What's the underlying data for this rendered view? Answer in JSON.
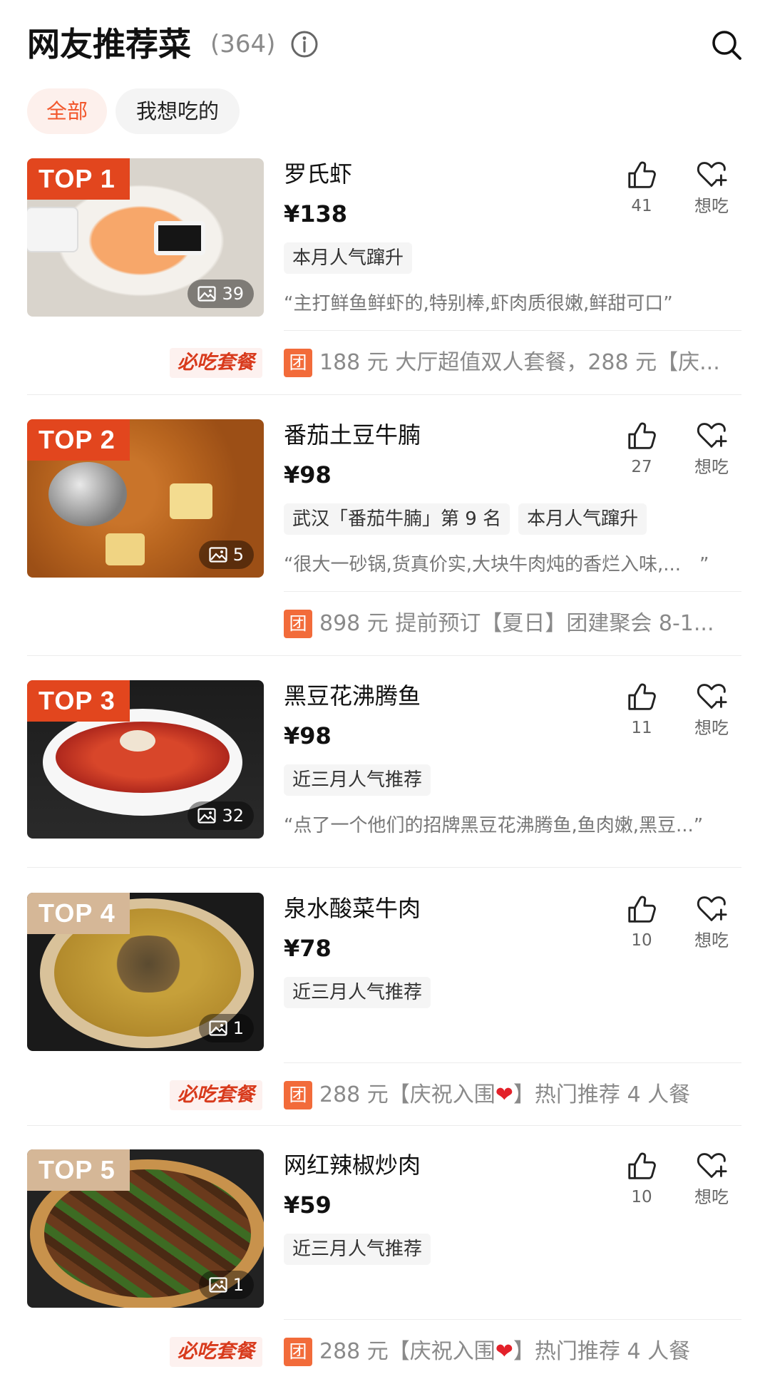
{
  "header": {
    "title": "网友推荐菜",
    "count": "(364)",
    "info_icon": "info-icon",
    "search_icon": "search-icon"
  },
  "filters": [
    {
      "label": "全部",
      "active": true
    },
    {
      "label": "我想吃的",
      "active": false
    }
  ],
  "colors": {
    "accent": "#f2582d",
    "badge_top": "#e2461e",
    "badge_other": "#d5b797"
  },
  "dishes": [
    {
      "rank": "TOP 1",
      "name": "罗氏虾",
      "price": "¥138",
      "tags": [
        "本月人气蹿升"
      ],
      "photos": "39",
      "likes": "41",
      "want_label": "想吃",
      "quote": "“主打鲜鱼鲜虾的,特别棒,虾肉质很嫩,鲜甜可口”",
      "deal": {
        "badge": "必吃套餐",
        "icon": "团",
        "text": "188 元 大厅超值双人套餐，288 元【庆..."
      }
    },
    {
      "rank": "TOP 2",
      "name": "番茄土豆牛腩",
      "price": "¥98",
      "tags": [
        "武汉「番茄牛腩」第 9 名",
        "本月人气蹿升"
      ],
      "photos": "5",
      "likes": "27",
      "want_label": "想吃",
      "quote": "“很大一砂锅,货真价实,大块牛肉炖的香烂入味,...　”",
      "deal": {
        "badge": "",
        "icon": "团",
        "text": "898 元 提前预订【夏日】团建聚会 8-1..."
      }
    },
    {
      "rank": "TOP 3",
      "name": "黑豆花沸腾鱼",
      "price": "¥98",
      "tags": [
        "近三月人气推荐"
      ],
      "photos": "32",
      "likes": "11",
      "want_label": "想吃",
      "quote": "“点了一个他们的招牌黑豆花沸腾鱼,鱼肉嫩,黑豆...”"
    },
    {
      "rank": "TOP 4",
      "name": "泉水酸菜牛肉",
      "price": "¥78",
      "tags": [
        "近三月人气推荐"
      ],
      "photos": "1",
      "likes": "10",
      "want_label": "想吃",
      "deal": {
        "badge": "必吃套餐",
        "icon": "团",
        "text_a": "288 元【庆祝入围",
        "heart": "❤",
        "text_b": "】热门推荐 4 人餐"
      }
    },
    {
      "rank": "TOP 5",
      "name": "网红辣椒炒肉",
      "price": "¥59",
      "tags": [
        "近三月人气推荐"
      ],
      "photos": "1",
      "likes": "10",
      "want_label": "想吃",
      "deal": {
        "badge": "必吃套餐",
        "icon": "团",
        "text_a": "288 元【庆祝入围",
        "heart": "❤",
        "text_b": "】热门推荐 4 人餐"
      }
    }
  ]
}
